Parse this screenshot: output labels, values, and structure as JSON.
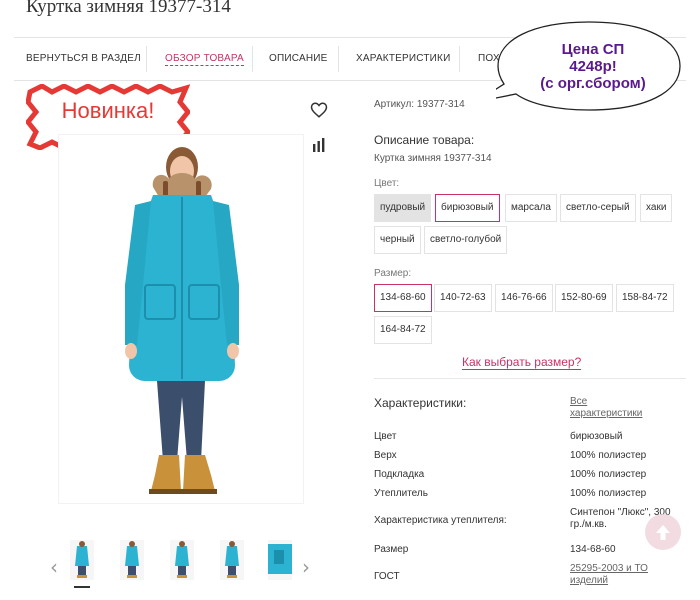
{
  "page": {
    "title": "Куртка зимняя 19377-314"
  },
  "tabs": [
    {
      "label": "ВЕРНУТЬСЯ В РАЗДЕЛ"
    },
    {
      "label": "ОБЗОР ТОВАРА"
    },
    {
      "label": "ОПИСАНИЕ"
    },
    {
      "label": "ХАРАКТЕРИСТИКИ"
    },
    {
      "label": "ПОХ"
    }
  ],
  "callout": {
    "line1": "Цена СП",
    "line2": "4248р!",
    "line3": "(с орг.сбором)"
  },
  "badge": {
    "text": "Новинка!"
  },
  "icons": {
    "favorite": "heart-icon",
    "compare": "bar-chart-icon",
    "prev": "chevron-left-icon",
    "next": "chevron-right-icon",
    "scroll_top": "arrow-up-icon"
  },
  "product": {
    "article": "Артикул: 19377-314",
    "desc_heading": "Описание товара:",
    "desc_text": "Куртка зимняя 19377-314"
  },
  "colors": {
    "label": "Цвет:",
    "options": [
      "пудровый",
      "бирюзовый",
      "марсала",
      "светло-серый",
      "хаки",
      "черный",
      "светло-голубой"
    ]
  },
  "sizes": {
    "label": "Размер:",
    "options": [
      "134-68-60",
      "140-72-63",
      "146-76-66",
      "152-80-69",
      "158-84-72",
      "164-84-72"
    ]
  },
  "size_help": "Как выбрать размер?",
  "specs": {
    "heading": "Характеристики:",
    "all_line1": "Все",
    "all_line2": "характеристики",
    "rows": [
      {
        "k": "Цвет",
        "v": "бирюзовый"
      },
      {
        "k": "Верх",
        "v": "100% полиэстер"
      },
      {
        "k": "Подкладка",
        "v": "100% полиэстер"
      },
      {
        "k": "Утеплитель",
        "v": "100% полиэстер"
      },
      {
        "k": "Характеристика утеплителя:",
        "v1": "Синтепон \"Люкс\", 300",
        "v2": "гр./м.кв."
      },
      {
        "k": "Размер",
        "v": "134-68-60"
      },
      {
        "k": "ГОСТ",
        "v1": "25295-2003 и ТО",
        "v2": "изделий"
      }
    ]
  },
  "theme": {
    "accent": "#c83264",
    "callout_text": "#5a1a8c",
    "badge_red": "#e53935",
    "jacket": "#2bb3d1"
  }
}
